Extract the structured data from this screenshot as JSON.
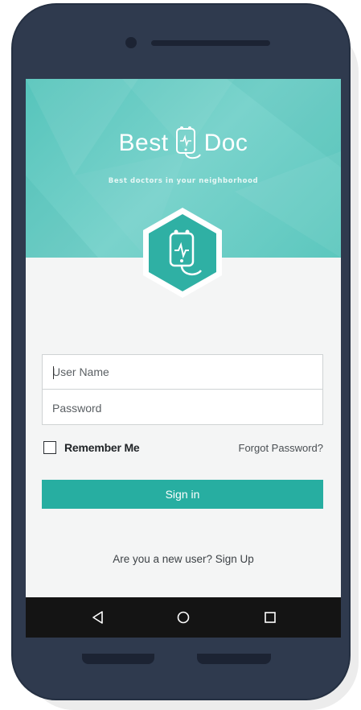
{
  "app": {
    "brand_left": "Best",
    "brand_right": "Doc",
    "tagline": "Best doctors in your neighborhood"
  },
  "login": {
    "username_placeholder": "User Name",
    "password_placeholder": "Password",
    "remember_label": "Remember Me",
    "remember_checked": false,
    "forgot_label": "Forgot Password?",
    "signin_label": "Sign in",
    "signup_label": "Are you a new user? Sign Up"
  },
  "navigation": {
    "back": "back-icon",
    "home": "home-icon",
    "recents": "recents-icon"
  },
  "colors": {
    "accent": "#27aea1",
    "hero": "#5cc7be",
    "device_frame": "#2f3a4e",
    "navbar": "#141414"
  }
}
